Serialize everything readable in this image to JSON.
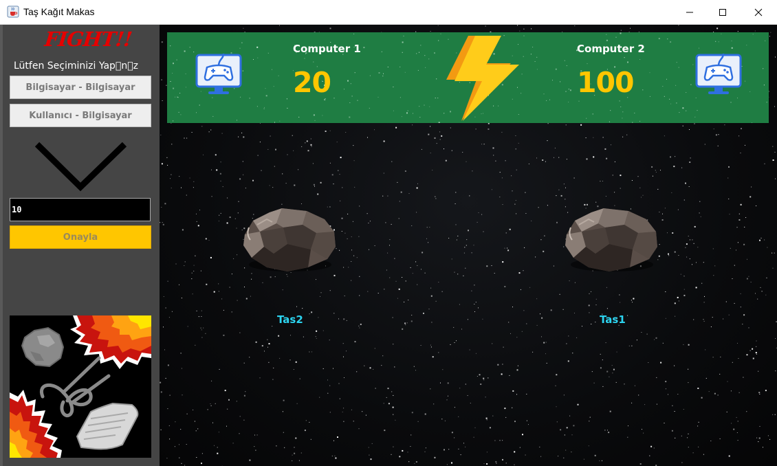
{
  "window": {
    "title": "Taş Kağıt Makas",
    "icon": "java-cup-icon"
  },
  "sidebar": {
    "heading": "FIGHT!!",
    "prompt": "Lütfen Seçiminizi Yap\u0000n\u0000z",
    "mode_buttons": [
      "Bilgisayar - Bilgisayar",
      "Kullanıcı - Bilgisayar"
    ],
    "decoration_icon": "chevron-down-icon",
    "rounds_value": "10",
    "confirm_label": "Onayla",
    "art_icon": "rock-paper-scissors-art"
  },
  "scoreboard": {
    "player1": {
      "name": "Computer 1",
      "score": "20",
      "icon": "monitor-gamepad-icon"
    },
    "player2": {
      "name": "Computer 2",
      "score": "100",
      "icon": "monitor-gamepad-icon"
    },
    "center_icon": "lightning-bolt-icon"
  },
  "arena": {
    "left": {
      "label": "Tas2",
      "icon": "rock-icon"
    },
    "right": {
      "label": "Tas1",
      "icon": "rock-icon"
    }
  },
  "colors": {
    "accent_yellow": "#ffc600",
    "banner_green": "#1f7d43",
    "heading_red": "#e60000",
    "label_cyan": "#2cd4f0",
    "sidebar_gray": "#454545"
  }
}
